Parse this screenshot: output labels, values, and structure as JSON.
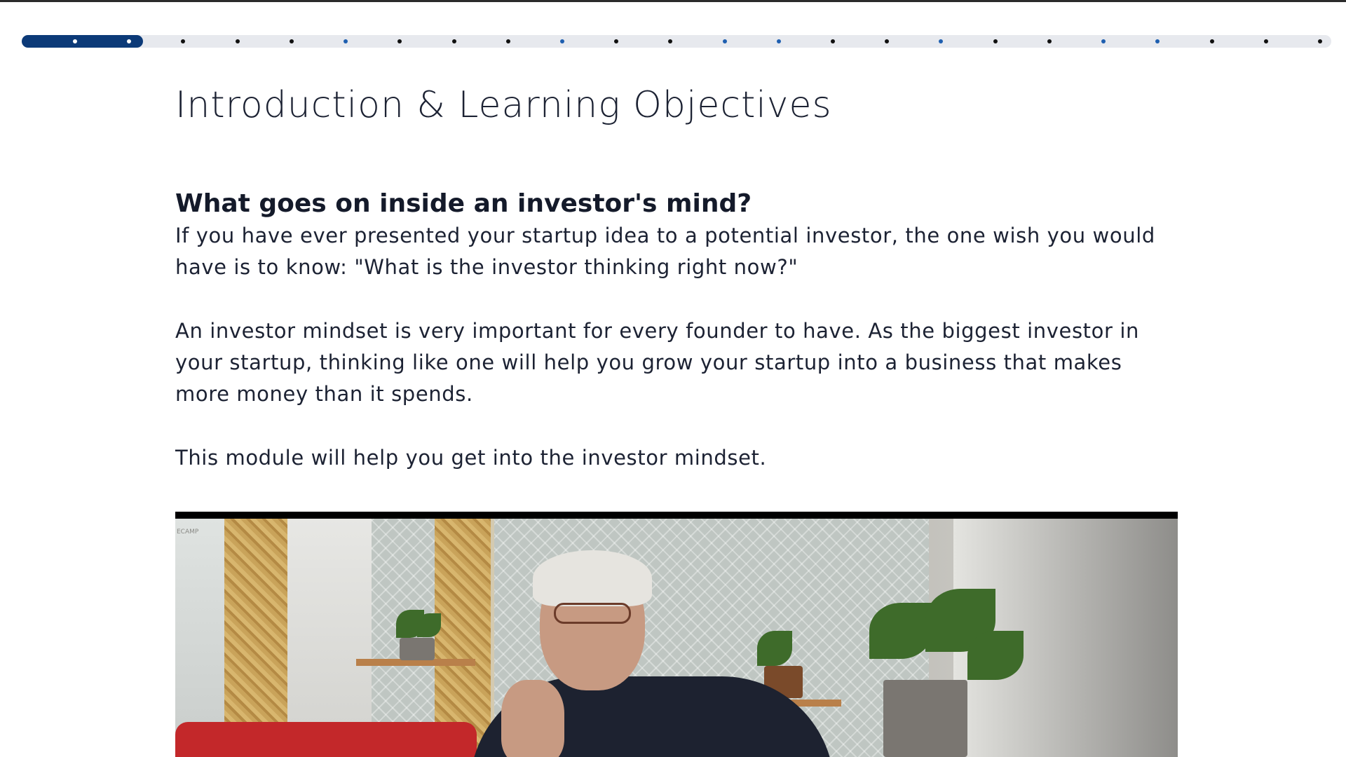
{
  "progress": {
    "total_steps": 24,
    "completed_steps": 2,
    "visited_steps": [
      5,
      9,
      12,
      13,
      16,
      19,
      20
    ]
  },
  "page": {
    "title": "Introduction & Learning Objectives",
    "section_heading": "What goes on inside an investor's mind?",
    "paragraphs": [
      "If you have ever presented your startup idea to a potential investor, the one wish you would have is to know:  \"What is the investor thinking right now?\"",
      "An investor mindset is very important for every founder to have. As the biggest investor in your startup, thinking like one will help you grow your startup into a business that makes more money than it spends.",
      "This module will help you get into the investor mindset."
    ]
  },
  "video": {
    "watermark": "ECAMP"
  },
  "colors": {
    "progress_fill": "#0c3a78",
    "progress_track": "#e7e9ee",
    "visited_dot": "#1f5fb0",
    "text": "#1c2233"
  }
}
